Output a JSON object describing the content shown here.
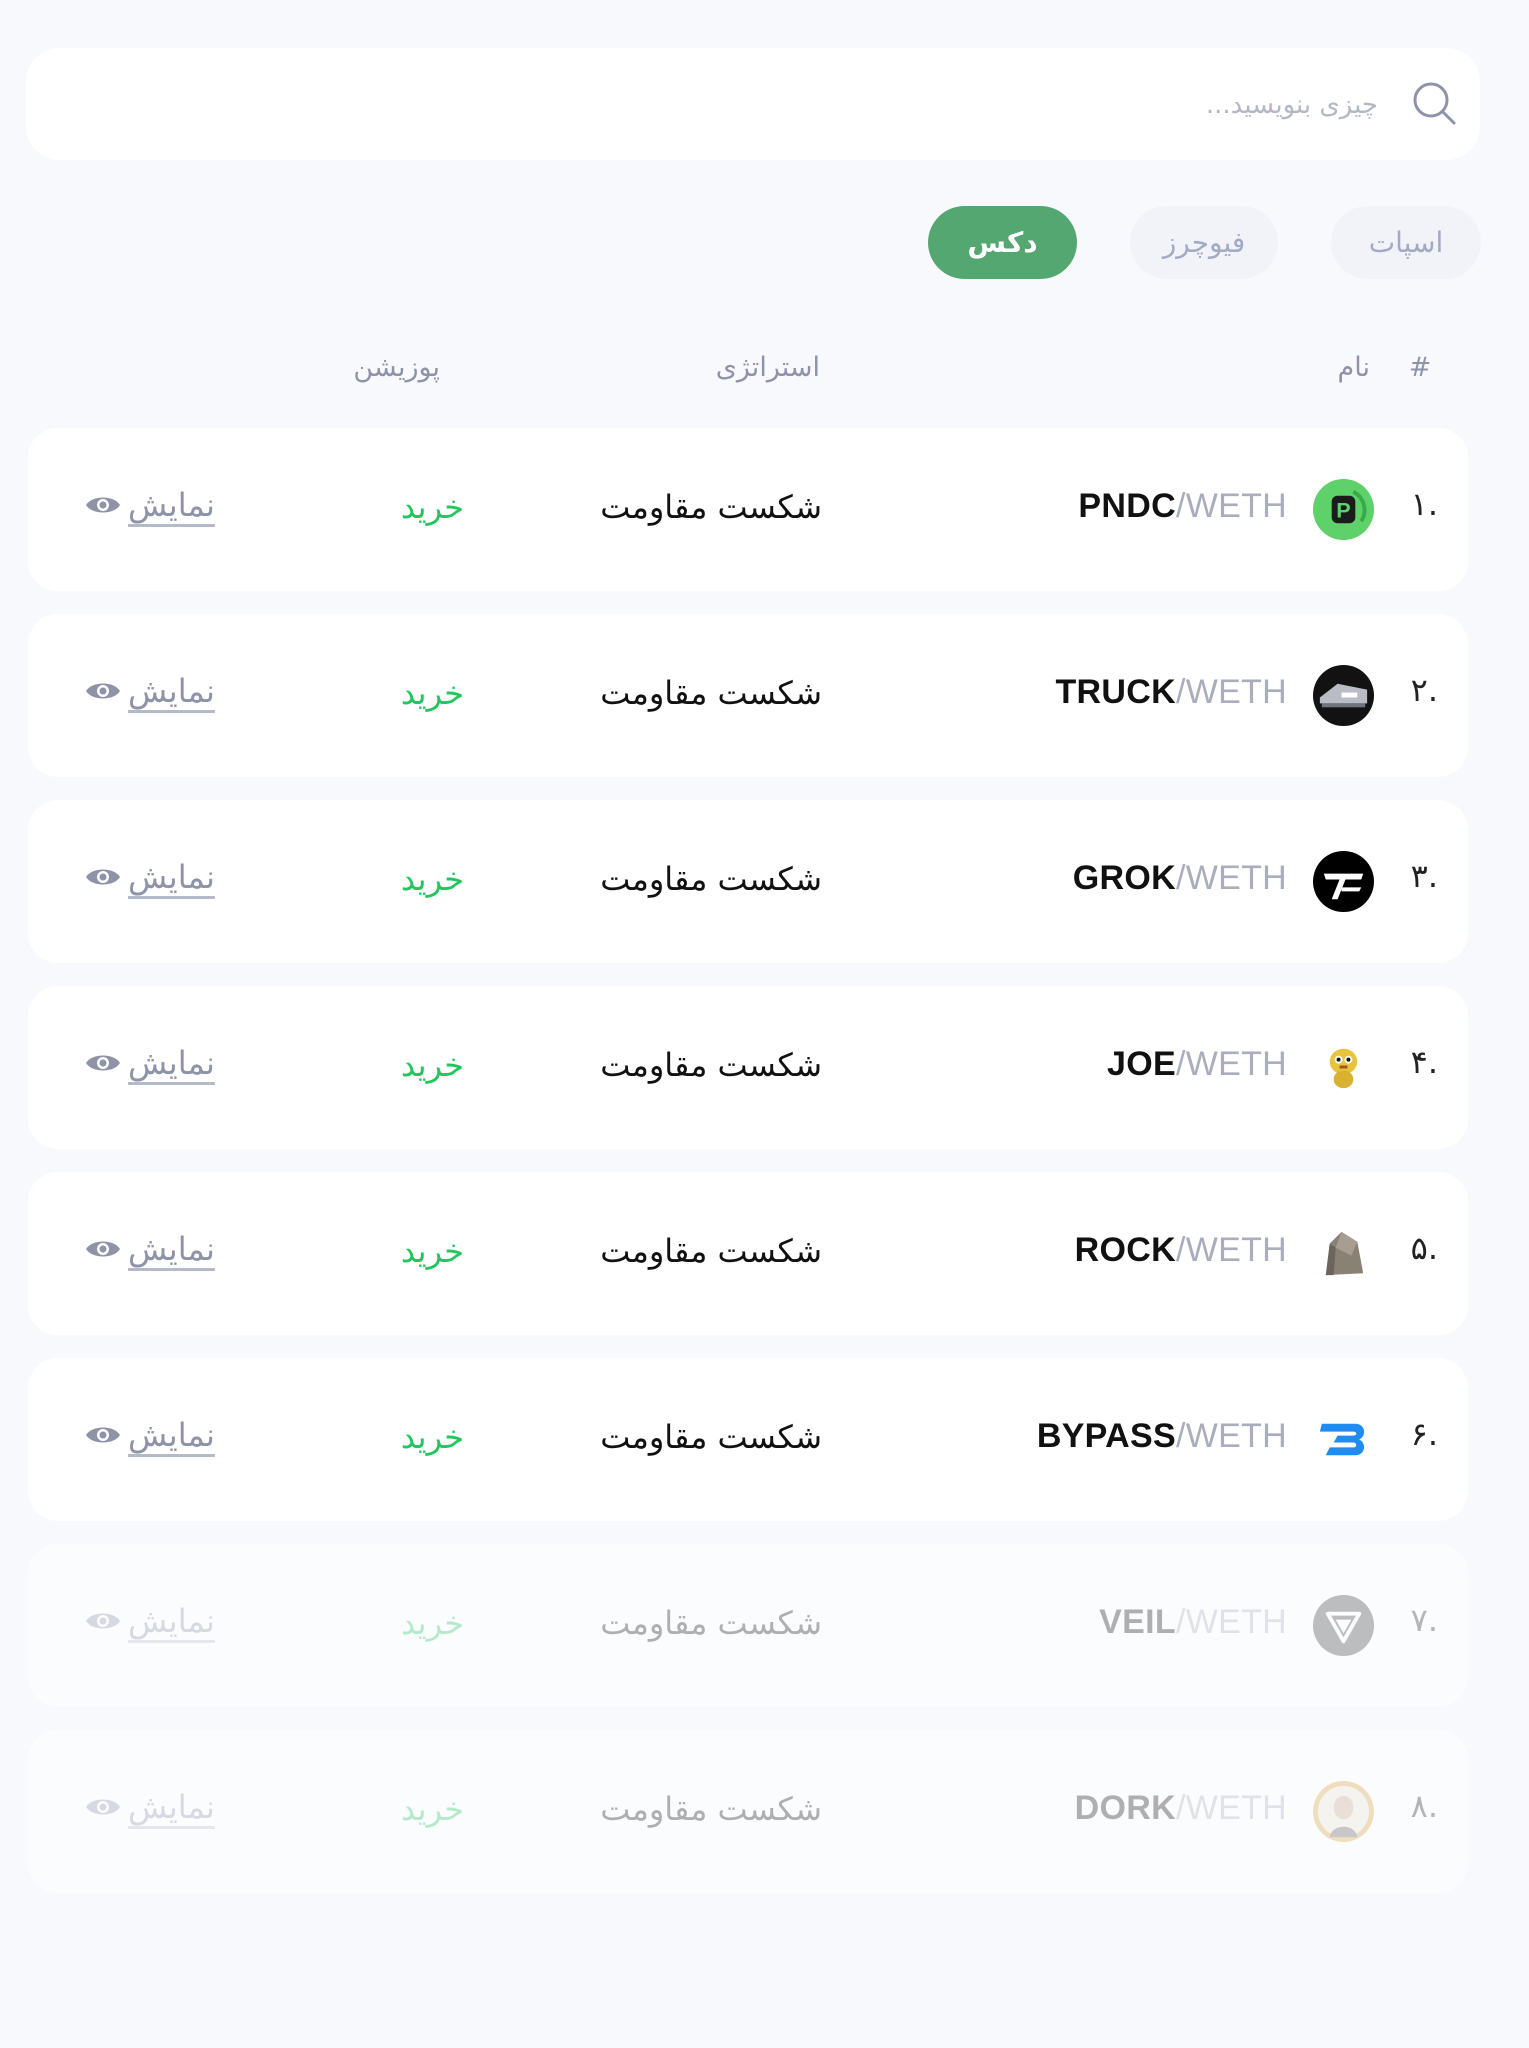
{
  "search": {
    "placeholder": "چیزی بنویسید..."
  },
  "tabs": [
    {
      "label": "اسپات",
      "active": false
    },
    {
      "label": "فیوچرز",
      "active": false
    },
    {
      "label": "دکس",
      "active": true
    }
  ],
  "table": {
    "headers": {
      "rank": "#",
      "name": "نام",
      "strategy": "استراتژی",
      "position": "پوزیشن"
    },
    "rows": [
      {
        "rank": ".۱",
        "base": "PNDC",
        "quote": "WETH",
        "icon": "pndc-logo-icon",
        "strategy": "شکست مقاومت",
        "position": "خرید",
        "action": "نمایش"
      },
      {
        "rank": ".۲",
        "base": "TRUCK",
        "quote": "WETH",
        "icon": "truck-logo-icon",
        "strategy": "شکست مقاومت",
        "position": "خرید",
        "action": "نمایش"
      },
      {
        "rank": ".۳",
        "base": "GROK",
        "quote": "WETH",
        "icon": "grok-logo-icon",
        "strategy": "شکست مقاومت",
        "position": "خرید",
        "action": "نمایش"
      },
      {
        "rank": ".۴",
        "base": "JOE",
        "quote": "WETH",
        "icon": "joe-logo-icon",
        "strategy": "شکست مقاومت",
        "position": "خرید",
        "action": "نمایش"
      },
      {
        "rank": ".۵",
        "base": "ROCK",
        "quote": "WETH",
        "icon": "rock-logo-icon",
        "strategy": "شکست مقاومت",
        "position": "خرید",
        "action": "نمایش"
      },
      {
        "rank": ".۶",
        "base": "BYPASS",
        "quote": "WETH",
        "icon": "bypass-logo-icon",
        "strategy": "شکست مقاومت",
        "position": "خرید",
        "action": "نمایش"
      },
      {
        "rank": ".۷",
        "base": "VEIL",
        "quote": "WETH",
        "icon": "veil-logo-icon",
        "strategy": "شکست مقاومت",
        "position": "خرید",
        "action": "نمایش"
      },
      {
        "rank": ".۸",
        "base": "DORK",
        "quote": "WETH",
        "icon": "dork-logo-icon",
        "strategy": "شکست مقاومت",
        "position": "خرید",
        "action": "نمایش"
      }
    ]
  },
  "colors": {
    "accent": "#55a772",
    "buy": "#22c55e",
    "muted": "#a9adbc",
    "background": "#f8f9fd"
  }
}
